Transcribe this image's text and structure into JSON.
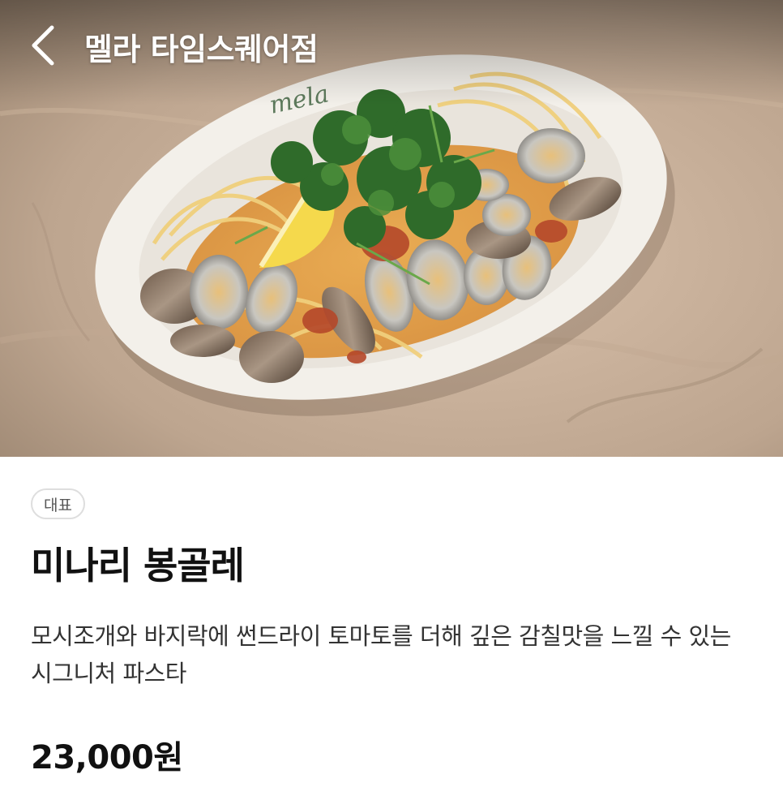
{
  "header": {
    "back_icon": "chevron-left-icon",
    "title": "멜라 타임스퀘어점"
  },
  "hero_image": {
    "subject": "food-photo",
    "plate_logo": "mela"
  },
  "menu": {
    "badge": "대표",
    "name": "미나리 봉골레",
    "description": "모시조개와 바지락에 썬드라이 토마토를 더해 깊은 감칠맛을 느낄 수 있는 시그니처 파스타",
    "price": "23,000원"
  },
  "colors": {
    "header_text": "#ffffff",
    "badge_border": "#dedede",
    "primary_text": "#111111",
    "description_text": "#333333"
  }
}
